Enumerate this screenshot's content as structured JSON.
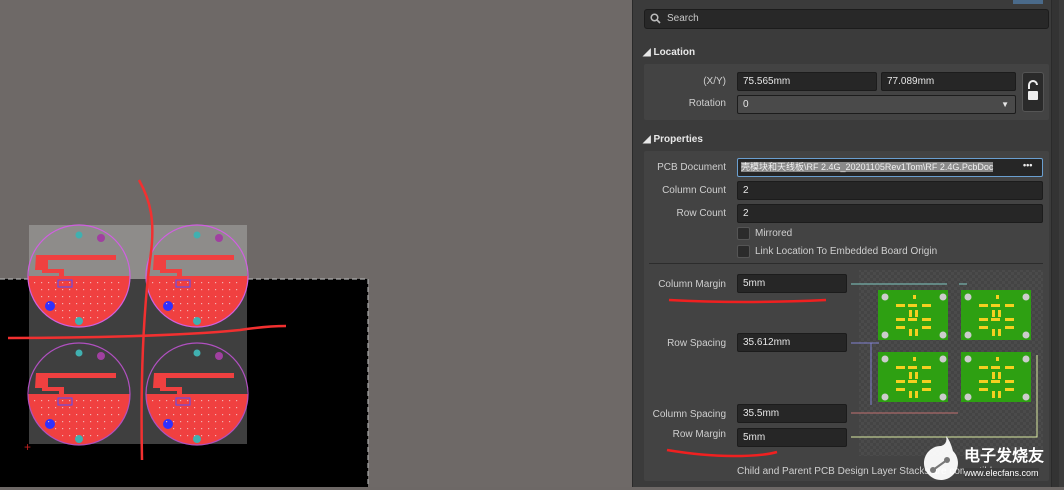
{
  "search": {
    "placeholder": "Search"
  },
  "location": {
    "title": "Location",
    "xy_label": "(X/Y)",
    "x": "75.565mm",
    "y": "77.089mm",
    "rotation_label": "Rotation",
    "rotation": "0",
    "lock_icon": "unlock-icon"
  },
  "properties": {
    "title": "Properties",
    "pcb_document_label": "PCB Document",
    "pcb_document": "壳模块和天线板\\RF 2.4G_20201105Rev1Tom\\RF 2.4G.PcbDoc",
    "column_count_label": "Column Count",
    "column_count": "2",
    "row_count_label": "Row Count",
    "row_count": "2",
    "mirrored_label": "Mirrored",
    "mirrored": false,
    "link_label": "Link Location To Embedded Board Origin",
    "link": false,
    "column_margin_label": "Column Margin",
    "column_margin": "5mm",
    "row_spacing_label": "Row Spacing",
    "row_spacing": "35.612mm",
    "column_spacing_label": "Column Spacing",
    "column_spacing": "35.5mm",
    "row_margin_label": "Row Margin",
    "row_margin": "5mm",
    "footer": "Child and Parent PCB Design Layer Stacks are compatible"
  },
  "watermark": {
    "text": "电子发烧友",
    "url": "www.elecfans.com"
  },
  "colors": {
    "copper": "#f04040",
    "board_green": "#2ea012",
    "pad_yellow": "#f5d020",
    "accent_blue": "#5a9fd8"
  }
}
